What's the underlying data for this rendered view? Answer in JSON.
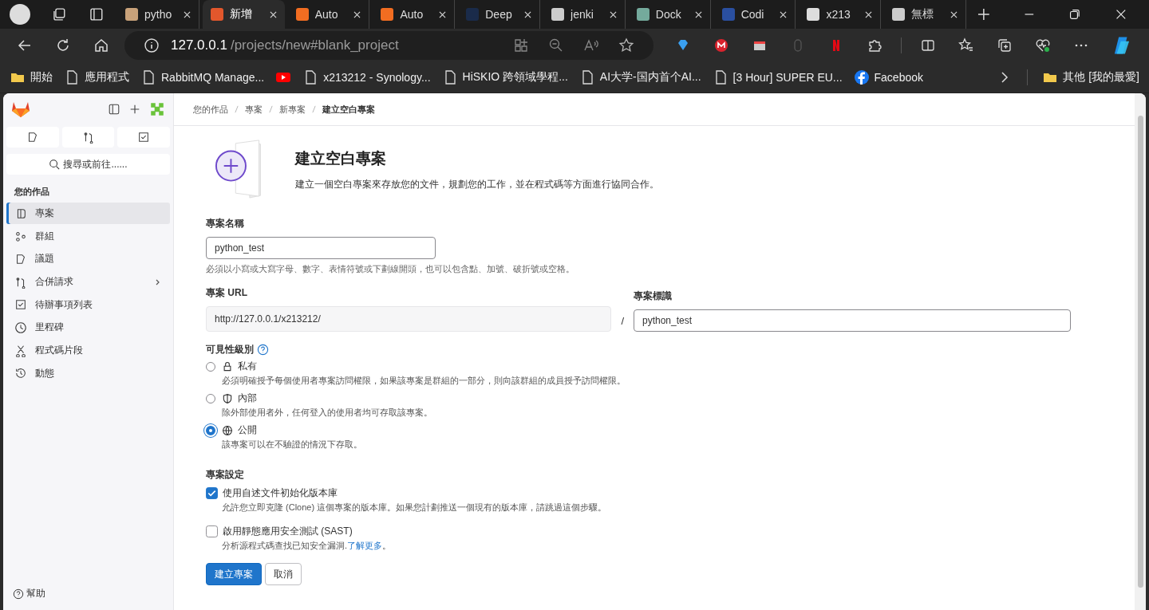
{
  "browser": {
    "tabs": [
      {
        "title": "pytho",
        "selected": false
      },
      {
        "title": "新增",
        "selected": true
      },
      {
        "title": "Auto",
        "selected": false
      },
      {
        "title": "Auto",
        "selected": false
      },
      {
        "title": "Deep",
        "selected": false
      },
      {
        "title": "jenki",
        "selected": false
      },
      {
        "title": "Dock",
        "selected": false
      },
      {
        "title": "Codi",
        "selected": false
      },
      {
        "title": "x213",
        "selected": false
      },
      {
        "title": "無標",
        "selected": false
      }
    ],
    "address": {
      "host": "127.0.0.1",
      "path": "/projects/new#blank_project"
    },
    "bookmarks": [
      {
        "kind": "folder",
        "label": "開始"
      },
      {
        "kind": "page",
        "label": "應用程式"
      },
      {
        "kind": "page",
        "label": "RabbitMQ Manage..."
      },
      {
        "kind": "video"
      },
      {
        "kind": "page",
        "label": "x213212 - Synology..."
      },
      {
        "kind": "page",
        "label": "HiSKIO 跨領域學程..."
      },
      {
        "kind": "page",
        "label": "AI大学-国内首个AI..."
      },
      {
        "kind": "page",
        "label": "[3 Hour] SUPER EU..."
      },
      {
        "kind": "social",
        "label": "Facebook"
      }
    ],
    "other_bookmarks": "其他 [我的最愛]"
  },
  "sidebar": {
    "search": "搜尋或前往......",
    "section": "您的作品",
    "items": [
      {
        "label": "專案",
        "selected": true,
        "expandable": false
      },
      {
        "label": "群組",
        "selected": false,
        "expandable": false
      },
      {
        "label": "議題",
        "selected": false,
        "expandable": false
      },
      {
        "label": "合併請求",
        "selected": false,
        "expandable": true
      },
      {
        "label": "待辦事項列表",
        "selected": false,
        "expandable": false
      },
      {
        "label": "里程碑",
        "selected": false,
        "expandable": false
      },
      {
        "label": "程式碼片段",
        "selected": false,
        "expandable": false
      },
      {
        "label": "動態",
        "selected": false,
        "expandable": false
      }
    ],
    "help": "幫助"
  },
  "breadcrumbs": [
    "您的作品",
    "專案",
    "新專案",
    "建立空白專案"
  ],
  "form": {
    "title": "建立空白專案",
    "description": "建立一個空白專案來存放您的文件，規劃您的工作，並在程式碼等方面進行協同合作。",
    "name": {
      "label": "專案名稱",
      "value": "python_test",
      "hint": "必須以小寫或大寫字母、數字、表情符號或下劃線開頭，也可以包含點、加號、破折號或空格。"
    },
    "url": {
      "label": "專案 URL",
      "value": "http://127.0.0.1/x213212/",
      "separator": "/"
    },
    "slug": {
      "label": "專案標識",
      "value": "python_test"
    },
    "visibility": {
      "label": "可見性級別",
      "options": [
        {
          "label": "私有",
          "description": "必須明確授予每個使用者專案訪問權限，如果該專案是群組的一部分，則向該群組的成員授予訪問權限。",
          "selected": false
        },
        {
          "label": "內部",
          "description": "除外部使用者外，任何登入的使用者均可存取該專案。",
          "selected": false
        },
        {
          "label": "公開",
          "description": "該專案可以在不驗證的情況下存取。",
          "selected": true
        }
      ]
    },
    "settings": {
      "label": "專案設定",
      "options": [
        {
          "label": "使用自述文件初始化版本庫",
          "description": "允許您立即克隆 (Clone) 這個專案的版本庫。如果您計劃推送一個現有的版本庫，請跳過這個步驟。",
          "checked": true
        },
        {
          "label": "啟用靜態應用安全測試 (SAST)",
          "description": "分析源程式碼查找已知安全漏洞.",
          "link": "了解更多",
          "after": "。",
          "checked": false
        }
      ]
    },
    "submit": "建立專案",
    "cancel": "取消"
  }
}
